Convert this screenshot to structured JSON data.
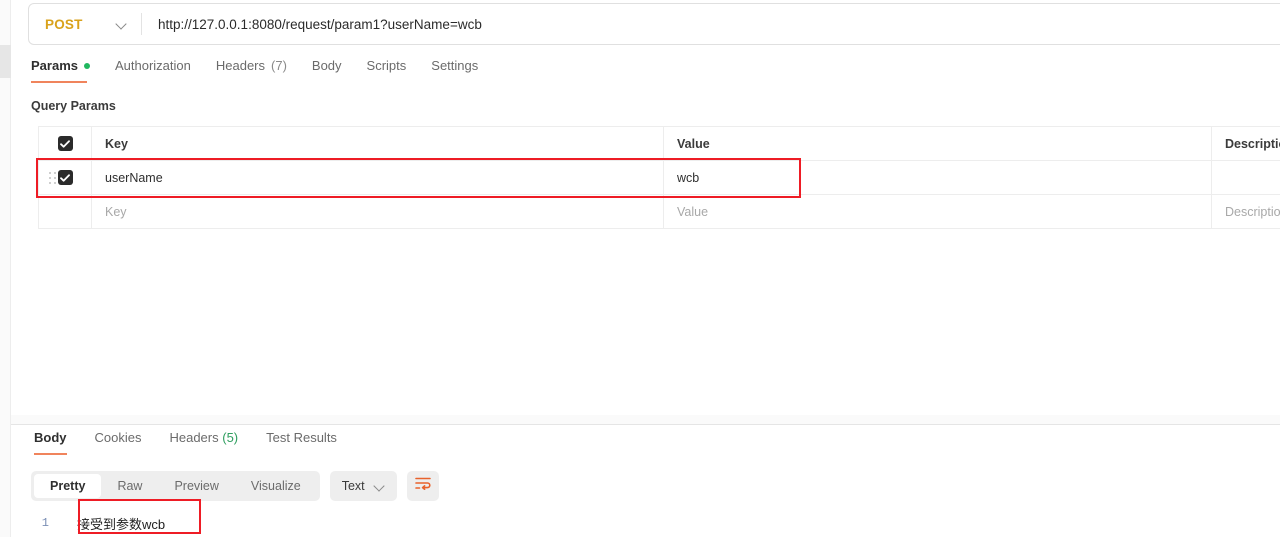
{
  "request": {
    "method": "POST",
    "url": "http://127.0.0.1:8080/request/param1?userName=wcb",
    "tabs": [
      {
        "label": "Params",
        "badge": "dot",
        "active": true
      },
      {
        "label": "Authorization",
        "badge": "",
        "active": false
      },
      {
        "label": "Headers",
        "badge": "(7)",
        "active": false
      },
      {
        "label": "Body",
        "badge": "",
        "active": false
      },
      {
        "label": "Scripts",
        "badge": "",
        "active": false
      },
      {
        "label": "Settings",
        "badge": "",
        "active": false
      }
    ],
    "section_title": "Query Params",
    "table": {
      "headers": [
        "Key",
        "Value",
        "Description"
      ],
      "rows": [
        {
          "checked": true,
          "key": "userName",
          "value": "wcb",
          "description": "",
          "highlighted": true
        }
      ],
      "placeholder_row": {
        "key": "Key",
        "value": "Value",
        "description": "Description"
      }
    }
  },
  "response": {
    "tabs": [
      {
        "label": "Body",
        "badge": "",
        "active": true
      },
      {
        "label": "Cookies",
        "badge": "",
        "active": false
      },
      {
        "label": "Headers",
        "badge": "(5)",
        "active": false
      },
      {
        "label": "Test Results",
        "badge": "",
        "active": false
      }
    ],
    "view_modes": [
      "Pretty",
      "Raw",
      "Preview",
      "Visualize"
    ],
    "active_view_mode": "Pretty",
    "content_type": "Text",
    "wrap_icon": "word-wrap-icon",
    "body_lines": [
      {
        "number": "1",
        "text": "接受到参数wcb"
      }
    ]
  },
  "colors": {
    "method_accent": "#d9a21b",
    "tab_underline": "#f0845c",
    "annotation": "#ee1c25",
    "status_dot": "#21b75f",
    "count_green": "#2f9e5f"
  }
}
